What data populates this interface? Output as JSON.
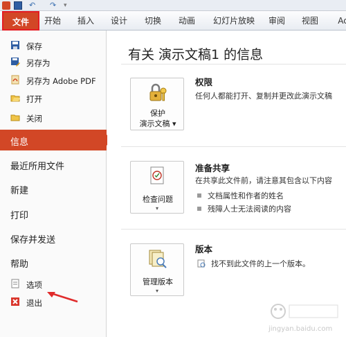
{
  "qat": {
    "undo_glyph": "↶",
    "redo_glyph": "↷",
    "more_glyph": "▾"
  },
  "ribbon": {
    "tabs": [
      {
        "label": "文件",
        "active": true
      },
      {
        "label": "开始"
      },
      {
        "label": "插入"
      },
      {
        "label": "设计"
      },
      {
        "label": "切换"
      },
      {
        "label": "动画"
      },
      {
        "label": "幻灯片放映"
      },
      {
        "label": "审阅"
      },
      {
        "label": "视图"
      },
      {
        "label": "Acr"
      }
    ]
  },
  "backstage_nav": {
    "commands": [
      {
        "label": "保存",
        "icon": "save-icon"
      },
      {
        "label": "另存为",
        "icon": "save-as-icon"
      },
      {
        "label": "另存为 Adobe PDF",
        "icon": "pdf-icon"
      },
      {
        "label": "打开",
        "icon": "open-folder-icon"
      },
      {
        "label": "关闭",
        "icon": "close-folder-icon"
      }
    ],
    "pages": [
      {
        "label": "信息",
        "active": true
      },
      {
        "label": "最近所用文件"
      },
      {
        "label": "新建"
      },
      {
        "label": "打印"
      },
      {
        "label": "保存并发送"
      },
      {
        "label": "帮助"
      }
    ],
    "footer": [
      {
        "label": "选项",
        "icon": "options-icon"
      },
      {
        "label": "退出",
        "icon": "exit-icon"
      }
    ]
  },
  "info": {
    "title": "有关 演示文稿1 的信息",
    "permissions": {
      "button_line1": "保护",
      "button_line2": "演示文稿",
      "heading": "权限",
      "description": "任何人都能打开、复制并更改此演示文稿"
    },
    "share": {
      "button_line1": "检查问题",
      "heading": "准备共享",
      "description": "在共享此文件前，请注意其包含以下内容",
      "bullets": [
        "文档属性和作者的姓名",
        "残障人士无法阅读的内容"
      ]
    },
    "versions": {
      "button_line1": "管理版本",
      "heading": "版本",
      "description": "找不到此文件的上一个版本。"
    }
  },
  "colors": {
    "accent": "#d24726",
    "highlight_box": "#e51c23",
    "annotation_arrow": "#e02b2b"
  },
  "watermark": {
    "caption": "jingyan.baidu.com"
  }
}
